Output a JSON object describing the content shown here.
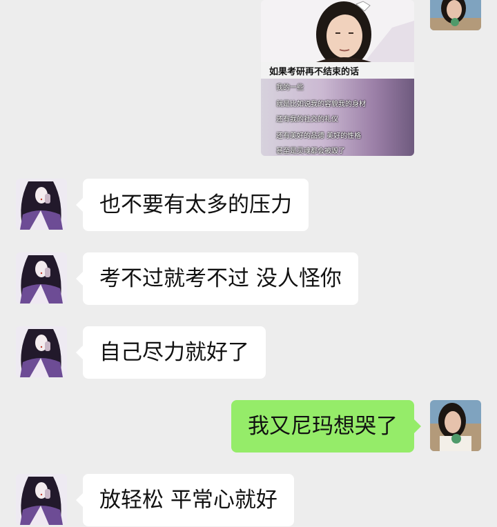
{
  "image_message": {
    "title": "如果考研再不结束的话",
    "lines": [
      "我的一些",
      "就是比如说我的容貌我的身材",
      "还有我的社交的礼仪",
      "还有美好的品德 美好的性格",
      "甚至是灵魂都会被毁了"
    ]
  },
  "messages": [
    {
      "side": "left",
      "text": "也不要有太多的压力"
    },
    {
      "side": "left",
      "text": "考不过就考不过 没人怪你"
    },
    {
      "side": "left",
      "text": "自己尽力就好了"
    },
    {
      "side": "right",
      "text": "我又尼玛想哭了"
    },
    {
      "side": "left",
      "text": "放轻松 平常心就好"
    }
  ],
  "colors": {
    "background": "#ededed",
    "incoming_bubble": "#ffffff",
    "outgoing_bubble": "#95ec69"
  }
}
